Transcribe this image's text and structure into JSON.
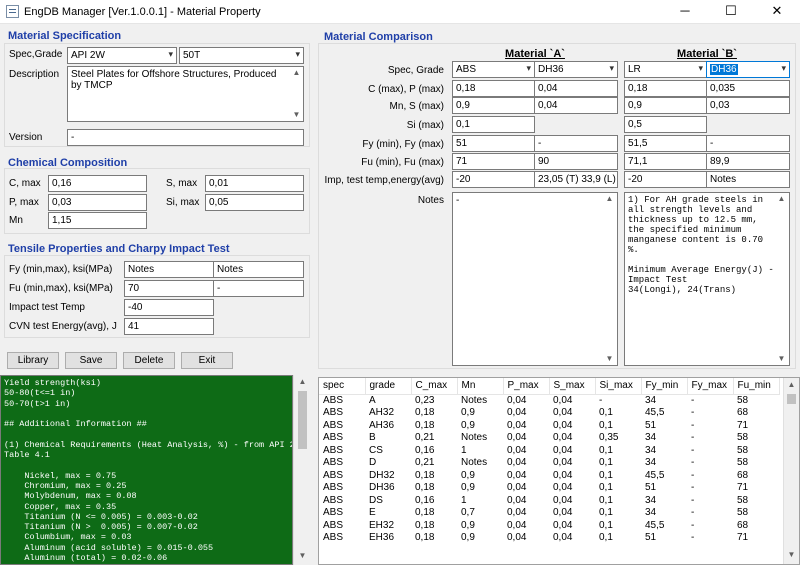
{
  "window": {
    "title": "EngDB Manager [Ver.1.0.0.1] - Material Property",
    "minimize": "─",
    "maximize": "☐",
    "close": "✕"
  },
  "spec": {
    "section_title": "Material Specification",
    "spec_grade_label": "Spec,Grade",
    "spec_value": "API 2W",
    "grade_value": "50T",
    "description_label": "Description",
    "description_value": "Steel Plates for Offshore Structures, Produced by TMCP",
    "version_label": "Version",
    "version_value": "-"
  },
  "chem": {
    "section_title": "Chemical Composition",
    "c_label": "C, max",
    "c_value": "0,16",
    "s_label": "S, max",
    "s_value": "0,01",
    "p_label": "P, max",
    "p_value": "0,03",
    "si_label": "Si, max",
    "si_value": "0,05",
    "mn_label": "Mn",
    "mn_value": "1,15"
  },
  "tensile": {
    "section_title": "Tensile Properties and Charpy Impact Test",
    "fy_label": "Fy (min,max), ksi(MPa)",
    "fy_min": "Notes",
    "fy_max": "Notes",
    "fu_label": "Fu (min,max), ksi(MPa)",
    "fu_min": "70",
    "fu_max": "-",
    "impact_temp_label": "Impact test Temp",
    "impact_temp_value": "-40",
    "cvn_label": "CVN test Energy(avg), J",
    "cvn_value": "41"
  },
  "buttons": {
    "library": "Library",
    "save": "Save",
    "delete": "Delete",
    "exit": "Exit"
  },
  "notes_text": "Yield strength(ksi)\n50-80(t<=1 in)\n50-70(t>1 in)\n\n## Additional Information ##\n\n(1) Chemical Requirements (Heat Analysis, %) - from API 2W\nTable 4.1\n\n    Nickel, max = 0.75\n    Chromium, max = 0.25\n    Molybdenum, max = 0.08\n    Copper, max = 0.35\n    Titanium (N <= 0.005) = 0.003-0.02\n    Titanium (N >  0.005) = 0.007-0.02\n    Columbium, max = 0.03\n    Aluminum (acid soluble) = 0.015-0.055\n    Aluminum (total) = 0.02-0.06",
  "comparison": {
    "section_title": "Material Comparison",
    "header_a": "Material `A`",
    "header_b": "Material `B`",
    "labels": {
      "spec_grade": "Spec, Grade",
      "c_p": "C (max), P (max)",
      "mn_s": "Mn, S (max)",
      "si": "Si (max)",
      "fy": "Fy (min), Fy (max)",
      "fu": "Fu (min), Fu (max)",
      "imp": "Imp, test temp,energy(avg)",
      "notes": "Notes"
    },
    "a": {
      "spec": "ABS",
      "grade": "DH36",
      "c": "0,18",
      "p": "0,04",
      "mn": "0,9",
      "s": "0,04",
      "si": "0,1",
      "fy_min": "51",
      "fy_max": "-",
      "fu_min": "71",
      "fu_max": "90",
      "imp_temp": "-20",
      "imp_energy": "23,05 (T)  33,9 (L)",
      "notes": "-"
    },
    "b": {
      "spec": "LR",
      "grade": "DH36",
      "c": "0,18",
      "p": "0,035",
      "mn": "0,9",
      "s": "0,03",
      "si": "0,5",
      "fy_min": "51,5",
      "fy_max": "-",
      "fu_min": "71,1",
      "fu_max": "89,9",
      "imp_temp": "-20",
      "imp_energy": "Notes",
      "notes": "1) For AH grade steels in all strength levels and thickness up to 12.5 mm, the specified minimum manganese content is 0.70 %.\n\nMinimum Average Energy(J) -\nImpact Test\n34(Longi), 24(Trans)"
    }
  },
  "table": {
    "columns": [
      "spec",
      "grade",
      "C_max",
      "Mn",
      "P_max",
      "S_max",
      "Si_max",
      "Fy_min",
      "Fy_max",
      "Fu_min"
    ],
    "rows": [
      [
        "ABS",
        "A",
        "0,23",
        "Notes",
        "0,04",
        "0,04",
        "-",
        "34",
        "-",
        "58"
      ],
      [
        "ABS",
        "AH32",
        "0,18",
        "0,9",
        "0,04",
        "0,04",
        "0,1",
        "45,5",
        "-",
        "68"
      ],
      [
        "ABS",
        "AH36",
        "0,18",
        "0,9",
        "0,04",
        "0,04",
        "0,1",
        "51",
        "-",
        "71"
      ],
      [
        "ABS",
        "B",
        "0,21",
        "Notes",
        "0,04",
        "0,04",
        "0,35",
        "34",
        "-",
        "58"
      ],
      [
        "ABS",
        "CS",
        "0,16",
        "1",
        "0,04",
        "0,04",
        "0,1",
        "34",
        "-",
        "58"
      ],
      [
        "ABS",
        "D",
        "0,21",
        "Notes",
        "0,04",
        "0,04",
        "0,1",
        "34",
        "-",
        "58"
      ],
      [
        "ABS",
        "DH32",
        "0,18",
        "0,9",
        "0,04",
        "0,04",
        "0,1",
        "45,5",
        "-",
        "68"
      ],
      [
        "ABS",
        "DH36",
        "0,18",
        "0,9",
        "0,04",
        "0,04",
        "0,1",
        "51",
        "-",
        "71"
      ],
      [
        "ABS",
        "DS",
        "0,16",
        "1",
        "0,04",
        "0,04",
        "0,1",
        "34",
        "-",
        "58"
      ],
      [
        "ABS",
        "E",
        "0,18",
        "0,7",
        "0,04",
        "0,04",
        "0,1",
        "34",
        "-",
        "58"
      ],
      [
        "ABS",
        "EH32",
        "0,18",
        "0,9",
        "0,04",
        "0,04",
        "0,1",
        "45,5",
        "-",
        "68"
      ],
      [
        "ABS",
        "EH36",
        "0,18",
        "0,9",
        "0,04",
        "0,04",
        "0,1",
        "51",
        "-",
        "71"
      ]
    ]
  }
}
